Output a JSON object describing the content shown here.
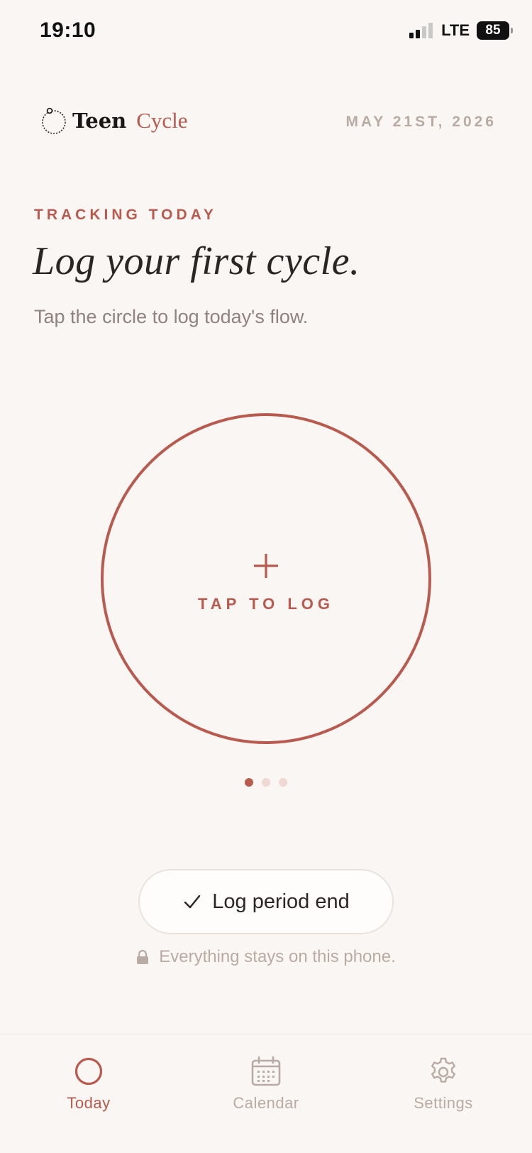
{
  "status_bar": {
    "time": "19:10",
    "network": "LTE",
    "battery": "85"
  },
  "header": {
    "brand_primary": "Teen",
    "brand_accent": "Cycle",
    "date": "MAY 21ST, 2026"
  },
  "main": {
    "eyebrow": "TRACKING TODAY",
    "title": "Log your first cycle.",
    "subtitle": "Tap the circle to log today's flow.",
    "tap_label": "TAP TO LOG",
    "page_indicator": {
      "count": 3,
      "active_index": 0
    },
    "end_button_label": "Log period end",
    "privacy_note": "Everything stays on this phone."
  },
  "tabbar": {
    "tabs": [
      {
        "label": "Today",
        "icon": "circle-icon",
        "active": true
      },
      {
        "label": "Calendar",
        "icon": "calendar-icon",
        "active": false
      },
      {
        "label": "Settings",
        "icon": "gear-icon",
        "active": false
      }
    ]
  },
  "colors": {
    "accent": "#b85a4d",
    "background": "#faf6f3",
    "muted": "#b9aaa3",
    "text": "#2b2523"
  }
}
